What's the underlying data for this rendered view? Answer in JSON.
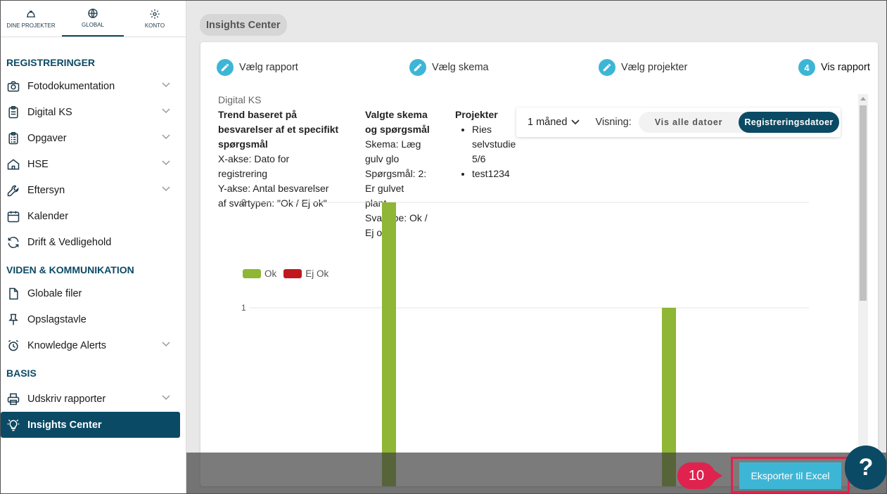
{
  "top_nav": [
    {
      "label": "DINE PROJEKTER",
      "icon": "hardhat-icon"
    },
    {
      "label": "GLOBAL",
      "icon": "globe-icon"
    },
    {
      "label": "KONTO",
      "icon": "gear-icon"
    }
  ],
  "sidebar": {
    "registreringer_title": "REGISTRERINGER",
    "registreringer": [
      {
        "label": "Fotodokumentation",
        "icon": "camera-icon"
      },
      {
        "label": "Digital KS",
        "icon": "clipboard-icon"
      },
      {
        "label": "Opgaver",
        "icon": "clipboard-list-icon"
      },
      {
        "label": "HSE",
        "icon": "house-icon"
      },
      {
        "label": "Eftersyn",
        "icon": "wrench-icon"
      },
      {
        "label": "Kalender",
        "icon": "calendar-icon"
      },
      {
        "label": "Drift & Vedligehold",
        "icon": "refresh-icon"
      }
    ],
    "viden_title": "VIDEN & KOMMUNIKATION",
    "viden": [
      {
        "label": "Globale filer",
        "icon": "file-icon"
      },
      {
        "label": "Opslagstavle",
        "icon": "pin-icon"
      },
      {
        "label": "Knowledge Alerts",
        "icon": "alarm-clock-icon"
      }
    ],
    "basis_title": "BASIS",
    "basis": [
      {
        "label": "Udskriv rapporter",
        "icon": "printer-icon"
      },
      {
        "label": "Insights Center",
        "icon": "lightbulb-icon"
      }
    ]
  },
  "breadcrumb": "Insights Center",
  "steps": [
    {
      "label": "Vælg rapport"
    },
    {
      "label": "Vælg skema"
    },
    {
      "label": "Vælg projekter"
    },
    {
      "number": "4",
      "label": "Vis rapport"
    }
  ],
  "report": {
    "module": "Digital KS",
    "title_lines": [
      "Trend baseret på",
      "besvarelser af et specifikt",
      "spørgsmål"
    ],
    "axis_lines": [
      "X-akse: Dato for",
      "registrering",
      "Y-akse: Antal besvarelser",
      "af svartypen: \"Ok / Ej ok\""
    ],
    "schema_title_lines": [
      "Valgte skema",
      "og spørgsmål"
    ],
    "schema_lines": [
      "Skema: Læg",
      "gulv glo",
      "Spørgsmål: 2:",
      "Er gulvet",
      "plant",
      "Svartype: Ok /",
      "Ej ok"
    ],
    "projects_title": "Projekter",
    "projects": [
      {
        "lines": [
          "Ries",
          "selvstudie",
          "5/6"
        ]
      },
      {
        "lines": [
          "test1234"
        ]
      }
    ]
  },
  "controls": {
    "range_label": "1 måned",
    "visning_label": "Visning:",
    "option_all": "Vis alle datoer",
    "option_reg": "Registreringsdatoer"
  },
  "chart_data": {
    "type": "bar",
    "series": [
      {
        "name": "Ok",
        "color": "#8fb634",
        "values": [
          2,
          1
        ]
      },
      {
        "name": "Ej Ok",
        "color": "#c0181e",
        "values": [
          0,
          0
        ]
      }
    ],
    "y_ticks": [
      "1",
      "2"
    ],
    "grid": true,
    "legend_position": "top-left"
  },
  "export_button": "Eksporter til Excel",
  "step_badge": "10",
  "help_label": "?"
}
